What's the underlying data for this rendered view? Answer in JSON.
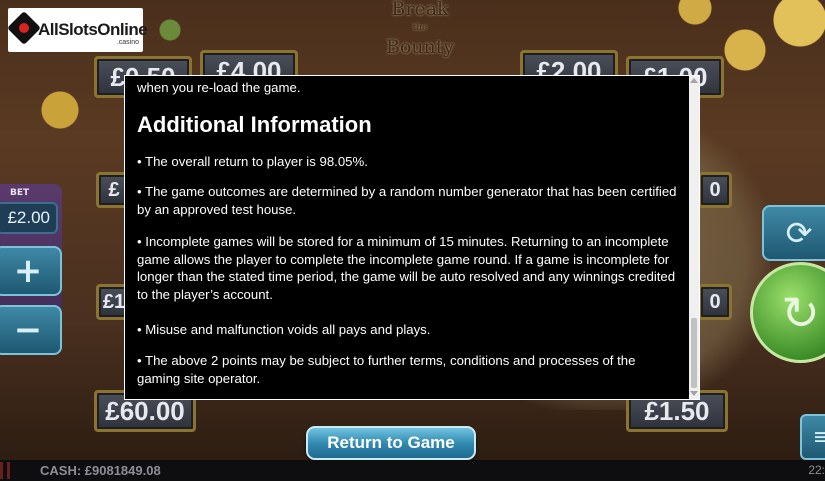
{
  "site_logo": {
    "text": "AllSlotsOnline",
    "sub": ".casino"
  },
  "game_title": {
    "line1": "Break",
    "line2": "the",
    "line3": "Bounty"
  },
  "prizes": {
    "top1": "£0.50",
    "top2": "£4.00",
    "top3": "£2.00",
    "top4": "£1.00",
    "left_mid1": "£",
    "left_mid2": "£1",
    "right_mid1": "0",
    "right_mid2": "0",
    "bottom_left": "£60.00",
    "bottom_right": "£1.50"
  },
  "bet": {
    "label": "BET",
    "value": "£2.00",
    "plus": "+",
    "minus": "−"
  },
  "icons": {
    "refresh": "refresh-icon",
    "spin": "spin-arrow-icon",
    "menu": "menu-icon"
  },
  "info": {
    "top_text": "when you re-load the game.",
    "heading": "Additional Information",
    "bullets": [
      "• The overall return to player is 98.05%.",
      "• The game outcomes are determined by a random number generator that has been certified by an approved test house.",
      "• Incomplete games will be stored for a minimum of 15 minutes. Returning to an incomplete game allows the player to complete the incomplete game round. If a game is incomplete for longer than the stated time period, the game will be auto resolved and any winnings credited to the player’s account.",
      "• Misuse and malfunction voids all pays and plays.",
      "• The above 2 points may be subject to further terms, conditions and processes of the gaming site operator."
    ]
  },
  "return_button": "Return to Game",
  "status": {
    "cash": "CASH: £9081849.08",
    "clock": "22:"
  },
  "colors": {
    "accent": "#2f86ad",
    "modal_bg": "#000000"
  }
}
